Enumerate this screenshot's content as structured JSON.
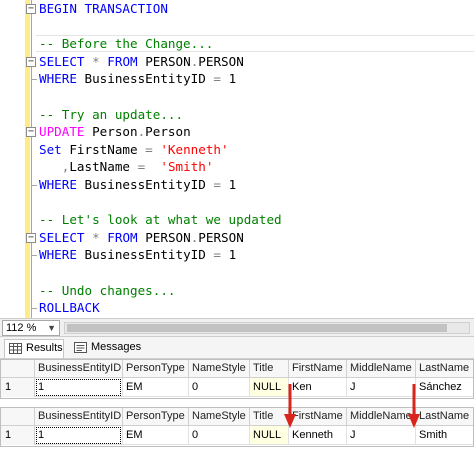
{
  "editor": {
    "lines": [
      [
        {
          "t": "BEGIN TRANSACTION",
          "c": "kw"
        }
      ],
      [],
      [
        {
          "t": "-- Before the Change...",
          "c": "cm"
        }
      ],
      [
        {
          "t": "SELECT",
          "c": "kw"
        },
        {
          "t": " ",
          "c": ""
        },
        {
          "t": "*",
          "c": "gr"
        },
        {
          "t": " ",
          "c": ""
        },
        {
          "t": "FROM",
          "c": "kw"
        },
        {
          "t": " PERSON",
          "c": ""
        },
        {
          "t": ".",
          "c": "gr"
        },
        {
          "t": "PERSON",
          "c": ""
        }
      ],
      [
        {
          "t": "WHERE",
          "c": "kw"
        },
        {
          "t": " BusinessEntityID ",
          "c": ""
        },
        {
          "t": "=",
          "c": "gr"
        },
        {
          "t": " 1",
          "c": ""
        }
      ],
      [],
      [
        {
          "t": "-- Try an update...",
          "c": "cm"
        }
      ],
      [
        {
          "t": "UPDATE",
          "c": "fn"
        },
        {
          "t": " Person",
          "c": ""
        },
        {
          "t": ".",
          "c": "gr"
        },
        {
          "t": "Person",
          "c": ""
        }
      ],
      [
        {
          "t": "Set",
          "c": "kw"
        },
        {
          "t": " FirstName ",
          "c": ""
        },
        {
          "t": "=",
          "c": "gr"
        },
        {
          "t": " ",
          "c": ""
        },
        {
          "t": "'Kenneth'",
          "c": "str"
        }
      ],
      [
        {
          "t": "   ",
          "c": ""
        },
        {
          "t": ",",
          "c": "gr"
        },
        {
          "t": "LastName ",
          "c": ""
        },
        {
          "t": "=",
          "c": "gr"
        },
        {
          "t": "  ",
          "c": ""
        },
        {
          "t": "'Smith'",
          "c": "str"
        }
      ],
      [
        {
          "t": "WHERE",
          "c": "kw"
        },
        {
          "t": " BusinessEntityID ",
          "c": ""
        },
        {
          "t": "=",
          "c": "gr"
        },
        {
          "t": " 1",
          "c": ""
        }
      ],
      [],
      [
        {
          "t": "-- Let's look at what we updated",
          "c": "cm"
        }
      ],
      [
        {
          "t": "SELECT",
          "c": "kw"
        },
        {
          "t": " ",
          "c": ""
        },
        {
          "t": "*",
          "c": "gr"
        },
        {
          "t": " ",
          "c": ""
        },
        {
          "t": "FROM",
          "c": "kw"
        },
        {
          "t": " PERSON",
          "c": ""
        },
        {
          "t": ".",
          "c": "gr"
        },
        {
          "t": "PERSON",
          "c": ""
        }
      ],
      [
        {
          "t": "WHERE",
          "c": "kw"
        },
        {
          "t": " BusinessEntityID ",
          "c": ""
        },
        {
          "t": "=",
          "c": "gr"
        },
        {
          "t": " 1",
          "c": ""
        }
      ],
      [],
      [
        {
          "t": "-- Undo changes...",
          "c": "cm"
        }
      ],
      [
        {
          "t": "ROLLBACK",
          "c": "kw"
        }
      ]
    ]
  },
  "zoom": {
    "value": "112 %",
    "arrow_icon": "chevron-down-icon"
  },
  "tabs": [
    {
      "label": "Results",
      "icon": "grid-icon",
      "active": true
    },
    {
      "label": "Messages",
      "icon": "messages-icon",
      "active": false
    }
  ],
  "grids": [
    {
      "columns": [
        "BusinessEntityID",
        "PersonType",
        "NameStyle",
        "Title",
        "FirstName",
        "MiddleName",
        "LastName"
      ],
      "rows": [
        {
          "num": "1",
          "cells": [
            "1",
            "EM",
            "0",
            "NULL",
            "Ken",
            "J",
            "Sánchez"
          ]
        }
      ]
    },
    {
      "columns": [
        "BusinessEntityID",
        "PersonType",
        "NameStyle",
        "Title",
        "FirstName",
        "MiddleName",
        "LastName"
      ],
      "rows": [
        {
          "num": "1",
          "cells": [
            "1",
            "EM",
            "0",
            "NULL",
            "Kenneth",
            "J",
            "Smith"
          ]
        }
      ]
    }
  ],
  "colors": {
    "keyword": "#0000ff",
    "comment": "#008000",
    "string": "#ff0000",
    "operator": "#808080",
    "function": "#ff00ff",
    "change_bar": "#ffec85",
    "null_cell": "#ffffe1",
    "annotation_arrow": "#d9261c"
  }
}
